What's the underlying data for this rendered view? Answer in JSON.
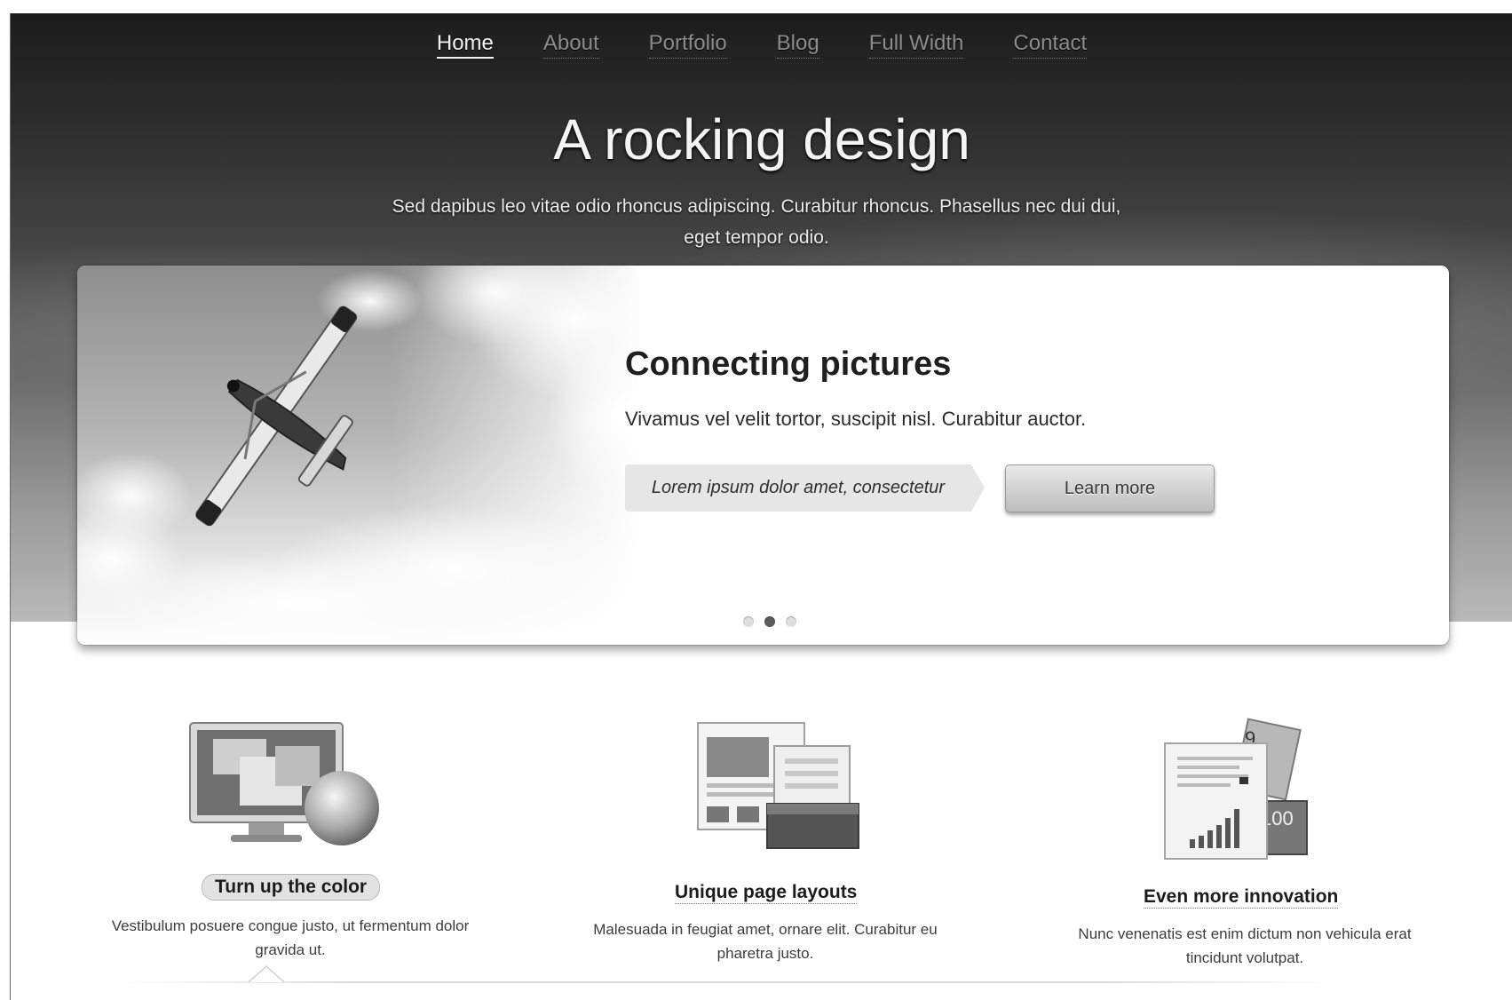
{
  "nav": {
    "items": [
      {
        "label": "Home",
        "active": true
      },
      {
        "label": "About",
        "active": false
      },
      {
        "label": "Portfolio",
        "active": false
      },
      {
        "label": "Blog",
        "active": false
      },
      {
        "label": "Full Width",
        "active": false
      },
      {
        "label": "Contact",
        "active": false
      }
    ]
  },
  "hero": {
    "title": "A rocking design",
    "subtitle": "Sed dapibus leo vitae odio rhoncus adipiscing. Curabitur rhoncus. Phasellus nec dui dui, eget tempor odio."
  },
  "slider": {
    "title": "Connecting pictures",
    "text": "Vivamus vel velit tortor, suscipit nisl. Curabitur auctor.",
    "tagline": "Lorem ipsum dolor amet, consectetur",
    "button_label": "Learn more",
    "slides_total": 3,
    "active_slide": 2
  },
  "features": [
    {
      "icon": "monitor-icon",
      "title": "Turn up the color",
      "text": "Vestibulum posuere congue justo, ut fermentum dolor gravida ut.",
      "highlighted": true
    },
    {
      "icon": "page-layouts-icon",
      "title": "Unique page layouts",
      "text": "Malesuada in feugiat amet, ornare elit. Curabitur eu pharetra justo.",
      "highlighted": false
    },
    {
      "icon": "documents-chart-icon",
      "title": "Even more innovation",
      "text": "Nunc venenatis est enim dictum non vehicula erat tincidunt volutpat.",
      "highlighted": false
    }
  ]
}
